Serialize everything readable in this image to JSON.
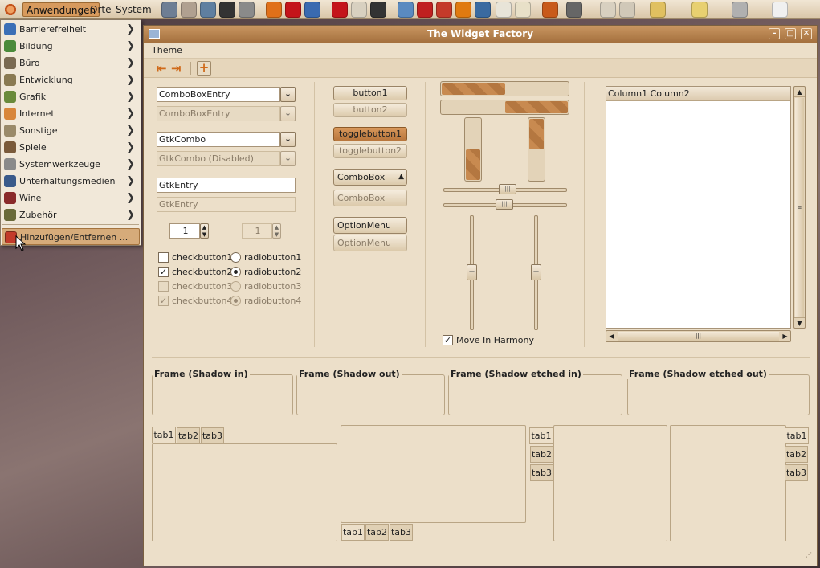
{
  "panel": {
    "menus": [
      {
        "label": "Anwendungen",
        "active": true
      },
      {
        "label": "Orte",
        "active": false
      },
      {
        "label": "System",
        "active": false
      }
    ],
    "tray_icons": [
      "camera-icon",
      "settings-icon",
      "network-icon",
      "terminal-icon",
      "tools-icon",
      "firefox-icon",
      "opera-icon",
      "editor-icon",
      "pdf-icon",
      "gear-icon",
      "dvd-icon",
      "box-icon",
      "mb-icon",
      "paint-icon",
      "vlc-icon",
      "clock-icon",
      "calculator-icon",
      "notes-icon",
      "theme-icon",
      "gimp-icon",
      "snail-icon",
      "speaker-icon",
      "network-tray-icon",
      "folder-icon",
      "battery-icon",
      "brightness-icon"
    ]
  },
  "appmenu": {
    "items": [
      {
        "label": "Barrierefreiheit",
        "icon": "accessibility-icon",
        "color": "#3b6fb6"
      },
      {
        "label": "Bildung",
        "icon": "education-icon",
        "color": "#4a8a3a"
      },
      {
        "label": "Büro",
        "icon": "office-icon",
        "color": "#7a6a52"
      },
      {
        "label": "Entwicklung",
        "icon": "development-icon",
        "color": "#8a7a52"
      },
      {
        "label": "Grafik",
        "icon": "graphics-icon",
        "color": "#6a8a3a"
      },
      {
        "label": "Internet",
        "icon": "internet-icon",
        "color": "#d8863a"
      },
      {
        "label": "Sonstige",
        "icon": "other-icon",
        "color": "#9a8a6a"
      },
      {
        "label": "Spiele",
        "icon": "games-icon",
        "color": "#7a5a3a"
      },
      {
        "label": "Systemwerkzeuge",
        "icon": "system-tools-icon",
        "color": "#8a8a8a"
      },
      {
        "label": "Unterhaltungsmedien",
        "icon": "multimedia-icon",
        "color": "#3a5a8a"
      },
      {
        "label": "Wine",
        "icon": "wine-icon",
        "color": "#8a2a2a"
      },
      {
        "label": "Zubehör",
        "icon": "accessories-icon",
        "color": "#6a6a3a"
      }
    ],
    "footer": {
      "label": "Hinzufügen/Entfernen ...",
      "icon": "add-remove-icon"
    }
  },
  "window": {
    "title": "The Widget Factory",
    "menu": [
      "Theme"
    ],
    "combos": {
      "entry1": "ComboBoxEntry",
      "entry2": "ComboBoxEntry",
      "gtk1": "GtkCombo",
      "gtk2": "GtkCombo (Disabled)",
      "entry3": "GtkEntry",
      "entry4": "GtkEntry"
    },
    "spin": {
      "v1": "1",
      "v2": "1"
    },
    "checks": [
      {
        "label": "checkbutton1",
        "checked": false,
        "disabled": false
      },
      {
        "label": "checkbutton2",
        "checked": true,
        "disabled": false
      },
      {
        "label": "checkbutton3",
        "checked": false,
        "disabled": true
      },
      {
        "label": "checkbutton4",
        "checked": true,
        "disabled": true
      }
    ],
    "radios": [
      {
        "label": "radiobutton1",
        "checked": false,
        "disabled": false
      },
      {
        "label": "radiobutton2",
        "checked": true,
        "disabled": false
      },
      {
        "label": "radiobutton3",
        "checked": false,
        "disabled": true
      },
      {
        "label": "radiobutton4",
        "checked": true,
        "disabled": true
      }
    ],
    "buttons": {
      "button1": "button1",
      "button2": "button2",
      "toggle1": "togglebutton1",
      "toggle2": "togglebutton2",
      "combo1": "ComboBox",
      "combo2": "ComboBox",
      "option1": "OptionMenu",
      "option2": "OptionMenu"
    },
    "progress": {
      "h1": 0.5,
      "h2": 0.5,
      "v1": 0.5,
      "v2": 0.5
    },
    "harmony": {
      "label": "Move In Harmony",
      "checked": true
    },
    "tree": {
      "columns": [
        "Column1",
        "Column2"
      ]
    },
    "frames": [
      "Frame (Shadow in)",
      "Frame (Shadow out)",
      "Frame (Shadow etched in)",
      "Frame (Shadow etched out)"
    ],
    "tabs": [
      "tab1",
      "tab2",
      "tab3"
    ]
  }
}
